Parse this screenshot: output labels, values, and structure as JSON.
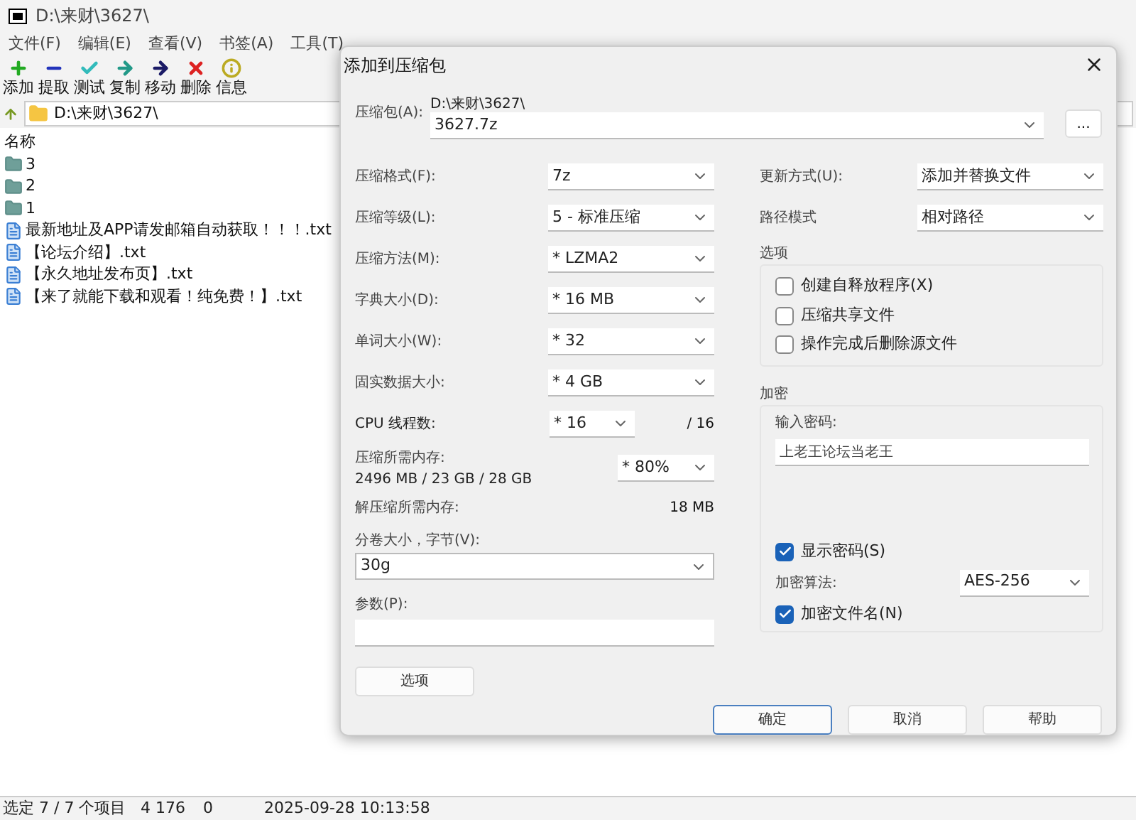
{
  "window": {
    "title": "D:\\来财\\3627\\"
  },
  "menu": [
    "文件(F)",
    "编辑(E)",
    "查看(V)",
    "书签(A)",
    "工具(T)"
  ],
  "toolbar": [
    {
      "kind": "add",
      "label": "添加"
    },
    {
      "kind": "extract",
      "label": "提取"
    },
    {
      "kind": "test",
      "label": "测试"
    },
    {
      "kind": "copy",
      "label": "复制"
    },
    {
      "kind": "move",
      "label": "移动"
    },
    {
      "kind": "delete",
      "label": "删除"
    },
    {
      "kind": "info",
      "label": "信息"
    }
  ],
  "address": "D:\\来财\\3627\\",
  "list": {
    "column": "名称",
    "items": [
      {
        "kind": "folder",
        "name": "3"
      },
      {
        "kind": "folder",
        "name": "2"
      },
      {
        "kind": "folder",
        "name": "1"
      },
      {
        "kind": "file",
        "name": "最新地址及APP请发邮箱自动获取！！！.txt"
      },
      {
        "kind": "file",
        "name": "【论坛介绍】.txt"
      },
      {
        "kind": "file",
        "name": "【永久地址发布页】.txt"
      },
      {
        "kind": "file",
        "name": "【来了就能下载和观看！纯免费！】.txt"
      }
    ]
  },
  "status_bar": [
    "选定 7 / 7 个项目",
    "4 176",
    "0",
    "2025-09-28 10:13:58"
  ],
  "dialog": {
    "title": "添加到压缩包",
    "archive_label": "压缩包(A):",
    "archive_path": "D:\\来财\\3627\\",
    "archive_name": "3627.7z",
    "browse": "...",
    "settings": [
      {
        "label": "压缩格式(F):",
        "value": "7z"
      },
      {
        "label": "压缩等级(L):",
        "value": "5 - 标准压缩"
      },
      {
        "label": "压缩方法(M):",
        "value": "*  LZMA2"
      },
      {
        "label": "字典大小(D):",
        "value": "*  16 MB"
      },
      {
        "label": "单词大小(W):",
        "value": "*  32"
      },
      {
        "label": "固实数据大小:",
        "value": "*  4 GB"
      }
    ],
    "cpu": {
      "label": "CPU 线程数:",
      "value": "*  16",
      "max": "/ 16"
    },
    "memory": {
      "label": "压缩所需内存:",
      "value": "2496 MB / 23 GB / 28 GB",
      "limit": "* 80%"
    },
    "decompress": {
      "label": "解压缩所需内存:",
      "value": "18 MB"
    },
    "volume": {
      "label": "分卷大小，字节(V):",
      "value": "30g"
    },
    "params": {
      "label": "参数(P):"
    },
    "options_button": "选项",
    "update": {
      "label": "更新方式(U):",
      "value": "添加并替换文件"
    },
    "path_mode": {
      "label": "路径模式",
      "value": "相对路径"
    },
    "options": {
      "title": "选项",
      "items": [
        {
          "label": "创建自释放程序(X)",
          "checked": false
        },
        {
          "label": "压缩共享文件",
          "checked": false
        },
        {
          "label": "操作完成后删除源文件",
          "checked": false
        }
      ]
    },
    "encryption": {
      "title": "加密",
      "password_label": "输入密码:",
      "password": "上老王论坛当老王",
      "show_password": {
        "label": "显示密码(S)",
        "checked": true
      },
      "method_label": "加密算法:",
      "method": "AES-256",
      "encrypt_names": {
        "label": "加密文件名(N)",
        "checked": true
      }
    },
    "buttons": [
      "确定",
      "取消",
      "帮助"
    ]
  }
}
